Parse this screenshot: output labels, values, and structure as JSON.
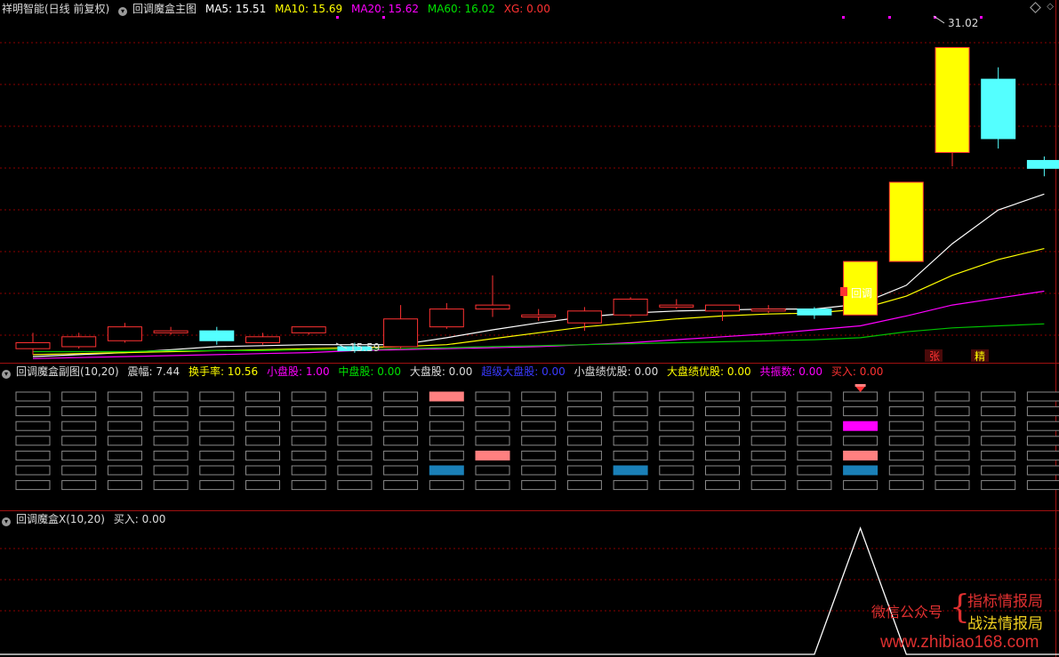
{
  "main_header": {
    "stock": "祥明智能(日线 前复权)",
    "indicator": "回调魔盒主图",
    "ma5": "MA5: 15.51",
    "ma10": "MA10: 15.69",
    "ma20": "MA20: 15.62",
    "ma60": "MA60: 16.02",
    "xg": "XG: 0.00"
  },
  "sub_header": {
    "title": "回调魔盒副图(10,20)",
    "amplitude": "震幅: 7.44",
    "turnover": "换手率: 10.56",
    "small_cap": "小盘股: 1.00",
    "mid_cap": "中盘股: 0.00",
    "large_cap": "大盘股: 0.00",
    "super_large": "超级大盘股: 0.00",
    "small_perf": "小盘绩优股: 0.00",
    "large_perf": "大盘绩优股: 0.00",
    "resonance": "共振数: 0.00",
    "buy": "买入: 0.00"
  },
  "sub2_header": {
    "title": "回调魔盒X(10,20)",
    "buy": "买入: 0.00"
  },
  "annotations": {
    "high_label": "31.02",
    "low_label": "15.59",
    "pullback_label": "回调",
    "zhang": "张",
    "jing": "精"
  },
  "watermark": {
    "wechat": "微信公众号",
    "name1": "指标情报局",
    "name2": "战法情报局",
    "url": "www.zhibiao168.com"
  },
  "colors": {
    "up_border": "#ff3232",
    "down_fill": "#54ffff",
    "signal_fill": "#ffff00",
    "ma5": "#ffffff",
    "ma10": "#ffff00",
    "ma20": "#ff00ff",
    "ma60": "#00c000",
    "grid": "#8b0000"
  },
  "chart_data": [
    {
      "type": "candlestick",
      "title": "回调魔盒主图",
      "ylim": [
        15.0,
        32.5
      ],
      "candles": [
        {
          "o": 15.8,
          "h": 16.6,
          "l": 15.5,
          "c": 16.1,
          "s": "up"
        },
        {
          "o": 15.9,
          "h": 16.6,
          "l": 15.8,
          "c": 16.4,
          "s": "up"
        },
        {
          "o": 16.2,
          "h": 17.1,
          "l": 16.1,
          "c": 16.9,
          "s": "up"
        },
        {
          "o": 16.6,
          "h": 16.9,
          "l": 16.5,
          "c": 16.7,
          "s": "up"
        },
        {
          "o": 16.7,
          "h": 16.9,
          "l": 16.0,
          "c": 16.2,
          "s": "down"
        },
        {
          "o": 16.1,
          "h": 16.6,
          "l": 16.0,
          "c": 16.4,
          "s": "up"
        },
        {
          "o": 16.6,
          "h": 16.9,
          "l": 16.5,
          "c": 16.9,
          "s": "up"
        },
        {
          "o": 15.9,
          "h": 16.1,
          "l": 15.59,
          "c": 15.7,
          "s": "down"
        },
        {
          "o": 15.9,
          "h": 18.0,
          "l": 15.8,
          "c": 17.3,
          "s": "up"
        },
        {
          "o": 16.9,
          "h": 18.1,
          "l": 16.8,
          "c": 17.8,
          "s": "up"
        },
        {
          "o": 17.8,
          "h": 19.5,
          "l": 17.4,
          "c": 18.0,
          "s": "up"
        },
        {
          "o": 17.4,
          "h": 17.8,
          "l": 17.2,
          "c": 17.5,
          "s": "up"
        },
        {
          "o": 17.1,
          "h": 17.9,
          "l": 16.7,
          "c": 17.7,
          "s": "up"
        },
        {
          "o": 17.5,
          "h": 18.4,
          "l": 17.4,
          "c": 18.3,
          "s": "up"
        },
        {
          "o": 17.9,
          "h": 18.3,
          "l": 17.8,
          "c": 18.0,
          "s": "up"
        },
        {
          "o": 17.7,
          "h": 18.0,
          "l": 17.2,
          "c": 18.0,
          "s": "up"
        },
        {
          "o": 17.7,
          "h": 18.0,
          "l": 17.6,
          "c": 17.8,
          "s": "up"
        },
        {
          "o": 17.8,
          "h": 17.9,
          "l": 17.3,
          "c": 17.5,
          "s": "down"
        },
        {
          "o": 17.5,
          "h": 20.2,
          "l": 17.5,
          "c": 20.2,
          "s": "signal"
        },
        {
          "o": 20.2,
          "h": 24.2,
          "l": 20.2,
          "c": 24.2,
          "s": "signal"
        },
        {
          "o": 25.7,
          "h": 31.02,
          "l": 25.0,
          "c": 31.0,
          "s": "signal"
        },
        {
          "o": 29.4,
          "h": 30.0,
          "l": 25.9,
          "c": 26.4,
          "s": "down"
        },
        {
          "o": 25.3,
          "h": 25.5,
          "l": 24.5,
          "c": 24.9,
          "s": "down"
        }
      ],
      "series": [
        {
          "name": "MA5",
          "values": [
            15.4,
            15.5,
            15.6,
            15.75,
            15.9,
            15.95,
            16.0,
            16.0,
            16.0,
            16.35,
            16.75,
            17.1,
            17.4,
            17.6,
            17.7,
            17.75,
            17.8,
            17.8,
            18.05,
            19.0,
            21.1,
            22.8,
            23.6
          ]
        },
        {
          "name": "MA10",
          "values": [
            15.5,
            15.55,
            15.6,
            15.65,
            15.7,
            15.75,
            15.8,
            15.85,
            15.9,
            16.0,
            16.3,
            16.6,
            16.9,
            17.1,
            17.3,
            17.45,
            17.55,
            17.6,
            17.8,
            18.45,
            19.5,
            20.3,
            20.85
          ]
        },
        {
          "name": "MA20",
          "values": [
            15.3,
            15.35,
            15.4,
            15.45,
            15.5,
            15.55,
            15.6,
            15.7,
            15.75,
            15.8,
            15.85,
            15.9,
            16.0,
            16.1,
            16.25,
            16.4,
            16.55,
            16.75,
            16.95,
            17.45,
            18.0,
            18.35,
            18.7
          ]
        },
        {
          "name": "MA60",
          "values": [
            15.65,
            15.65,
            15.65,
            15.7,
            15.7,
            15.7,
            15.75,
            15.75,
            15.8,
            15.85,
            15.9,
            15.95,
            16.0,
            16.05,
            16.1,
            16.15,
            16.2,
            16.25,
            16.35,
            16.65,
            16.85,
            16.95,
            17.05
          ]
        }
      ]
    },
    {
      "type": "heatmap",
      "title": "回调魔盒副图(10,20)",
      "rows": 7,
      "columns": 23,
      "filled": [
        {
          "col": 9,
          "row": 0,
          "color": "#ff8080"
        },
        {
          "col": 10,
          "row": 4,
          "color": "#ff8080"
        },
        {
          "col": 9,
          "row": 5,
          "color": "#1a80b8"
        },
        {
          "col": 13,
          "row": 5,
          "color": "#1a80b8"
        },
        {
          "col": 18,
          "row": 2,
          "color": "#ff00ff"
        },
        {
          "col": 18,
          "row": 4,
          "color": "#ff8080"
        },
        {
          "col": 18,
          "row": 5,
          "color": "#1a80b8"
        }
      ],
      "signal_col": 18
    },
    {
      "type": "line",
      "title": "回调魔盒X(10,20)",
      "ylim": [
        0,
        1
      ],
      "values": [
        0,
        0,
        0,
        0,
        0,
        0,
        0,
        0,
        0,
        0,
        0,
        0,
        0,
        0,
        0,
        0,
        0,
        0,
        1,
        0,
        0,
        0,
        0
      ]
    }
  ]
}
